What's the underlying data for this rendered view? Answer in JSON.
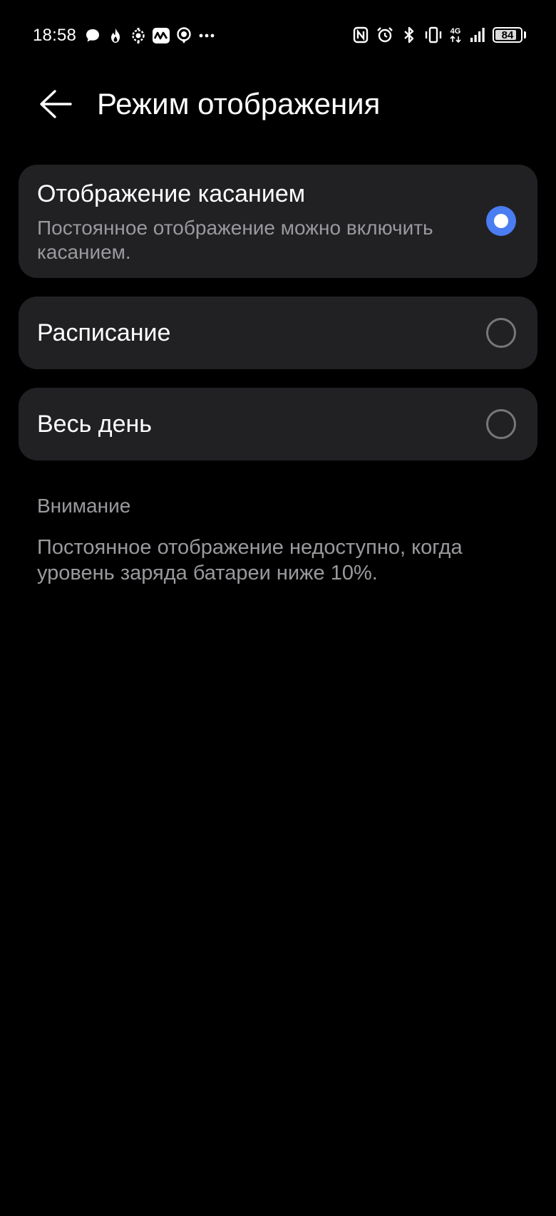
{
  "status_bar": {
    "time": "18:58",
    "left_icons": [
      "chat-bubble-icon",
      "flame-icon",
      "gear-bug-icon",
      "wave-app-icon",
      "location-pin-icon",
      "more-dots-icon"
    ],
    "right_icons": [
      "nfc-icon",
      "alarm-icon",
      "bluetooth-icon",
      "vibrate-icon",
      "network-4g-icon",
      "signal-icon"
    ],
    "network_label": "4G",
    "battery_percent": "84",
    "battery_level": 0.84
  },
  "header": {
    "title": "Режим отображения",
    "back_icon": "arrow-left-icon"
  },
  "options": [
    {
      "title": "Отображение касанием",
      "subtitle": "Постоянное отображение можно включить касанием.",
      "selected": true
    },
    {
      "title": "Расписание",
      "selected": false
    },
    {
      "title": "Весь день",
      "selected": false
    }
  ],
  "notice": {
    "heading": "Внимание",
    "text": "Постоянное отображение недоступно, когда уровень заряда батареи ниже 10%."
  },
  "colors": {
    "background": "#000000",
    "card": "#212124",
    "accent": "#4a7cf2",
    "secondary_text": "#9a9a9e"
  }
}
